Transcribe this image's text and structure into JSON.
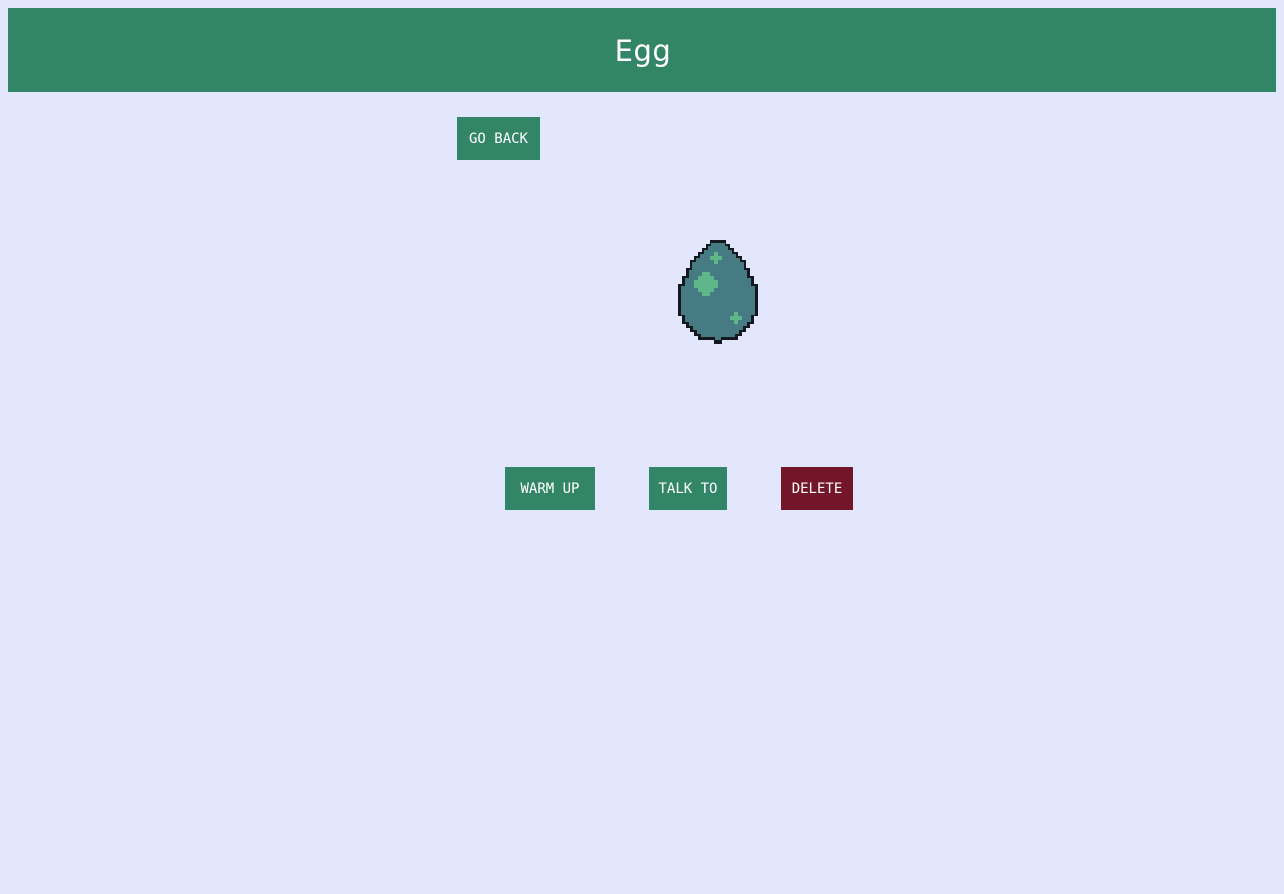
{
  "header": {
    "title": "Egg"
  },
  "nav": {
    "go_back_label": "GO BACK"
  },
  "pet": {
    "name": "Egg",
    "icon": "egg-icon",
    "colors": {
      "shell": "#467b83",
      "spots": "#5db789",
      "outline": "#16181f"
    }
  },
  "actions": {
    "warm_up_label": "WARM UP",
    "talk_to_label": "TALK TO",
    "delete_label": "DELETE"
  },
  "colors": {
    "background": "#e2e7fe",
    "primary": "#338567",
    "danger": "#74162a",
    "text": "#ffffff"
  }
}
